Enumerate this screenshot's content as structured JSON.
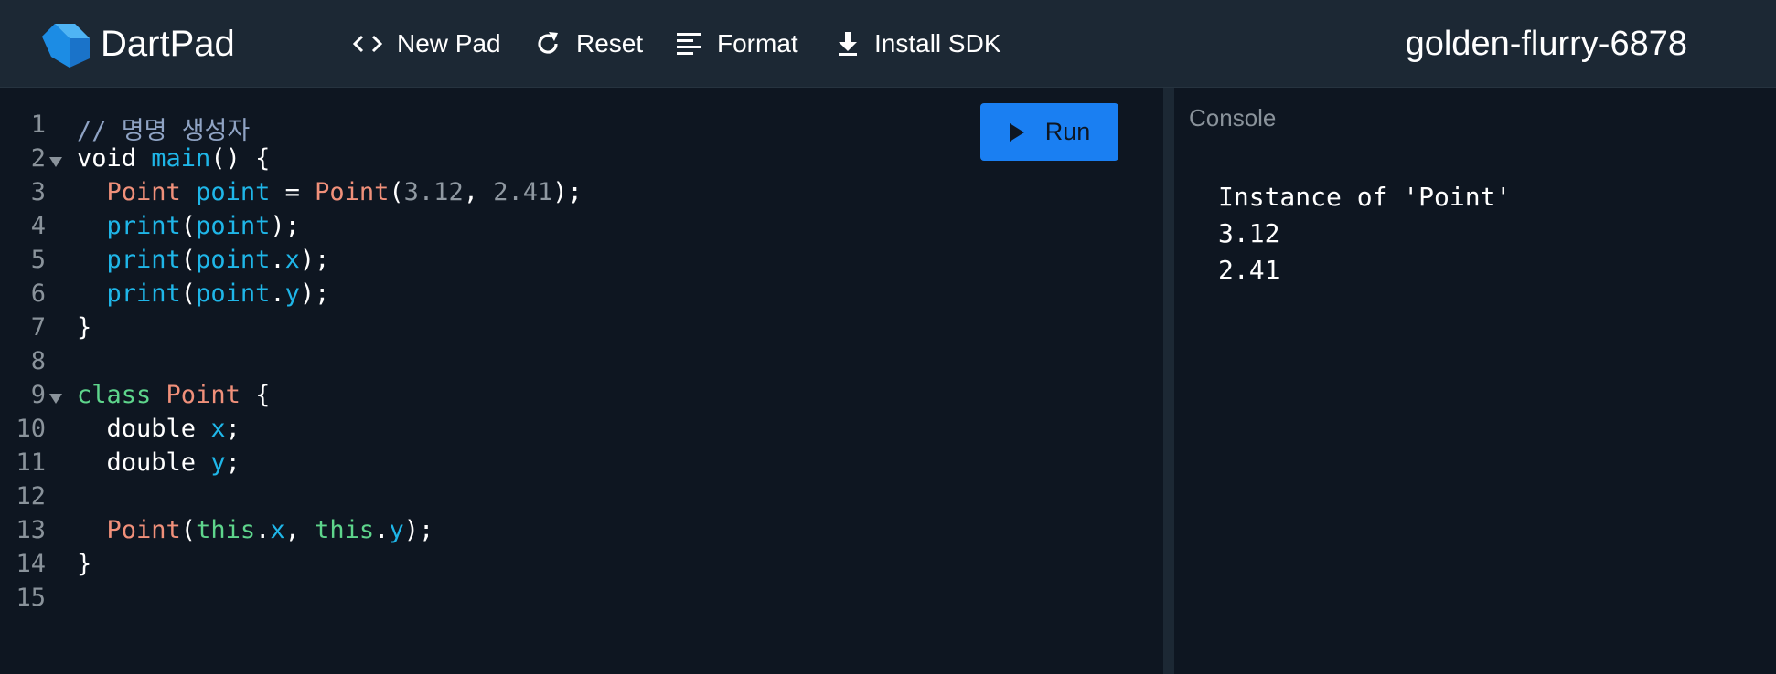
{
  "header": {
    "brand": "DartPad",
    "pad_name": "golden-flurry-6878",
    "buttons": {
      "new_pad": "New Pad",
      "reset": "Reset",
      "format": "Format",
      "install_sdk": "Install SDK"
    }
  },
  "editor": {
    "run_label": "Run",
    "lines": [
      {
        "n": "1",
        "fold": false,
        "tokens": [
          {
            "t": "// 명명 생성자",
            "c": "comment"
          }
        ]
      },
      {
        "n": "2",
        "fold": true,
        "tokens": [
          {
            "t": "void ",
            "c": "plain"
          },
          {
            "t": "main",
            "c": "ident"
          },
          {
            "t": "() {",
            "c": "plain"
          }
        ]
      },
      {
        "n": "3",
        "fold": false,
        "tokens": [
          {
            "t": "  ",
            "c": "plain"
          },
          {
            "t": "Point",
            "c": "type"
          },
          {
            "t": " ",
            "c": "plain"
          },
          {
            "t": "point",
            "c": "ident"
          },
          {
            "t": " = ",
            "c": "plain"
          },
          {
            "t": "Point",
            "c": "type"
          },
          {
            "t": "(",
            "c": "plain"
          },
          {
            "t": "3.12",
            "c": "num"
          },
          {
            "t": ", ",
            "c": "plain"
          },
          {
            "t": "2.41",
            "c": "num"
          },
          {
            "t": ");",
            "c": "plain"
          }
        ]
      },
      {
        "n": "4",
        "fold": false,
        "tokens": [
          {
            "t": "  ",
            "c": "plain"
          },
          {
            "t": "print",
            "c": "ident"
          },
          {
            "t": "(",
            "c": "plain"
          },
          {
            "t": "point",
            "c": "ident"
          },
          {
            "t": ");",
            "c": "plain"
          }
        ]
      },
      {
        "n": "5",
        "fold": false,
        "tokens": [
          {
            "t": "  ",
            "c": "plain"
          },
          {
            "t": "print",
            "c": "ident"
          },
          {
            "t": "(",
            "c": "plain"
          },
          {
            "t": "point",
            "c": "ident"
          },
          {
            "t": ".",
            "c": "plain"
          },
          {
            "t": "x",
            "c": "ident"
          },
          {
            "t": ");",
            "c": "plain"
          }
        ]
      },
      {
        "n": "6",
        "fold": false,
        "tokens": [
          {
            "t": "  ",
            "c": "plain"
          },
          {
            "t": "print",
            "c": "ident"
          },
          {
            "t": "(",
            "c": "plain"
          },
          {
            "t": "point",
            "c": "ident"
          },
          {
            "t": ".",
            "c": "plain"
          },
          {
            "t": "y",
            "c": "ident"
          },
          {
            "t": ");",
            "c": "plain"
          }
        ]
      },
      {
        "n": "7",
        "fold": false,
        "tokens": [
          {
            "t": "}",
            "c": "plain"
          }
        ]
      },
      {
        "n": "8",
        "fold": false,
        "tokens": []
      },
      {
        "n": "9",
        "fold": true,
        "tokens": [
          {
            "t": "class ",
            "c": "kw"
          },
          {
            "t": "Point",
            "c": "type"
          },
          {
            "t": " {",
            "c": "plain"
          }
        ]
      },
      {
        "n": "10",
        "fold": false,
        "tokens": [
          {
            "t": "  double ",
            "c": "plain"
          },
          {
            "t": "x",
            "c": "ident"
          },
          {
            "t": ";",
            "c": "plain"
          }
        ]
      },
      {
        "n": "11",
        "fold": false,
        "tokens": [
          {
            "t": "  double ",
            "c": "plain"
          },
          {
            "t": "y",
            "c": "ident"
          },
          {
            "t": ";",
            "c": "plain"
          }
        ]
      },
      {
        "n": "12",
        "fold": false,
        "tokens": []
      },
      {
        "n": "13",
        "fold": false,
        "tokens": [
          {
            "t": "  ",
            "c": "plain"
          },
          {
            "t": "Point",
            "c": "type"
          },
          {
            "t": "(",
            "c": "plain"
          },
          {
            "t": "this",
            "c": "kw"
          },
          {
            "t": ".",
            "c": "plain"
          },
          {
            "t": "x",
            "c": "ident"
          },
          {
            "t": ", ",
            "c": "plain"
          },
          {
            "t": "this",
            "c": "kw"
          },
          {
            "t": ".",
            "c": "plain"
          },
          {
            "t": "y",
            "c": "ident"
          },
          {
            "t": ");",
            "c": "plain"
          }
        ]
      },
      {
        "n": "14",
        "fold": false,
        "tokens": [
          {
            "t": "}",
            "c": "plain"
          }
        ]
      },
      {
        "n": "15",
        "fold": false,
        "tokens": []
      }
    ]
  },
  "console": {
    "label": "Console",
    "output": [
      "Instance of 'Point'",
      "3.12",
      "2.41"
    ]
  },
  "icons": {
    "logo": "dart-logo-icon",
    "new_pad": "code-brackets-icon",
    "reset": "refresh-icon",
    "format": "align-left-icon",
    "install_sdk": "download-icon",
    "run": "play-icon"
  },
  "colors": {
    "header_bg": "#1c2834",
    "editor_bg": "#0e1621",
    "accent": "#1a7ff2",
    "comment": "#8fa3c4",
    "type": "#f0907a",
    "identifier": "#1fb6e8",
    "number": "#9099a2",
    "keyword": "#5ed58c"
  }
}
